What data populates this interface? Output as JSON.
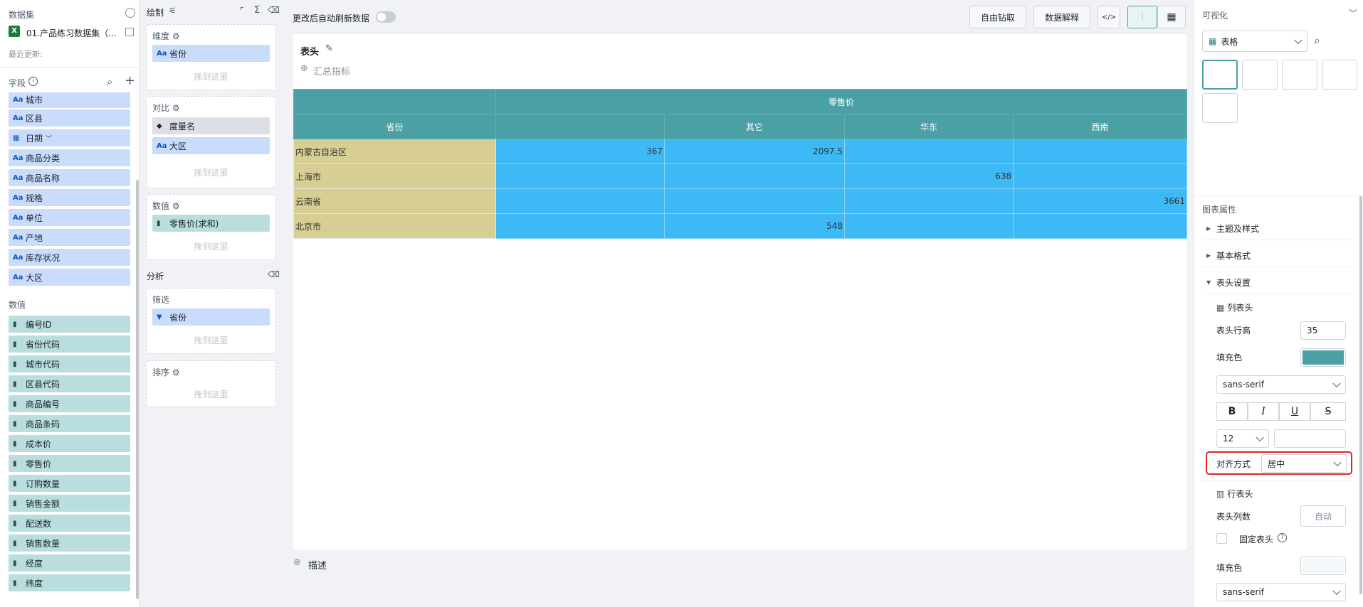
{
  "left": {
    "dataset_title": "数据集",
    "dataset_name": "01.产品练习数据集（...",
    "last_update": "最近更新:",
    "fields_title": "字段",
    "dimensions": [
      "城市",
      "区县",
      "日期",
      "商品分类",
      "商品名称",
      "规格",
      "单位",
      "产地",
      "库存状况",
      "大区"
    ],
    "measures_title": "数值",
    "measures": [
      "编号ID",
      "省份代码",
      "城市代码",
      "区县代码",
      "商品编号",
      "商品条码",
      "成本价",
      "零售价",
      "订购数量",
      "销售金额",
      "配送数",
      "销售数量",
      "经度",
      "纬度"
    ]
  },
  "mid": {
    "draw_title": "绘制",
    "dimension_title": "维度",
    "dimension_field": "省份",
    "drop_hint": "拖到这里",
    "compare_title": "对比",
    "compare_fields": [
      "度量名",
      "大区"
    ],
    "value_title": "数值",
    "value_field": "零售价(求和)",
    "analysis_title": "分析",
    "filter_title": "筛选",
    "filter_field": "省份",
    "sort_title": "排序"
  },
  "main": {
    "auto_refresh_label": "更改后自动刷新数据",
    "btn_drill": "自由钻取",
    "btn_explain": "数据解释",
    "btn_code": "</>",
    "chart_title": "表头",
    "add_summary": "汇总指标",
    "describe": "描述",
    "table": {
      "top_header": "零售价",
      "row_header_title": "省份",
      "columns": [
        "",
        "其它",
        "华东",
        "西南"
      ],
      "rows": [
        {
          "name": "内蒙古自治区",
          "values": [
            "367",
            "2097.5",
            "",
            ""
          ]
        },
        {
          "name": "上海市",
          "values": [
            "",
            "",
            "638",
            ""
          ]
        },
        {
          "name": "云南省",
          "values": [
            "",
            "",
            "",
            "3661"
          ]
        },
        {
          "name": "北京市",
          "values": [
            "",
            "548",
            "",
            ""
          ]
        }
      ]
    }
  },
  "right": {
    "viz_title": "可视化",
    "viz_type": "表格",
    "props_title": "图表属性",
    "sec_theme": "主题及样式",
    "sec_basic": "基本格式",
    "sec_header": "表头设置",
    "col_header": "列表头",
    "header_row_height_label": "表头行高",
    "header_row_height": "35",
    "fill_color_label": "填充色",
    "fill_color": "#4aa0a5",
    "font_family": "sans-serif",
    "fmt_bold": "B",
    "fmt_italic": "I",
    "fmt_underline": "U",
    "fmt_strike": "S",
    "font_size": "12",
    "align_label": "对齐方式",
    "align_value": "居中",
    "row_header": "行表头",
    "header_cols_label": "表头列数",
    "header_cols_value": "自动",
    "fixed_header_label": "固定表头",
    "fill_color2_label": "填充色",
    "fill_color2": "#f2f8f8",
    "font_family2": "sans-serif"
  }
}
